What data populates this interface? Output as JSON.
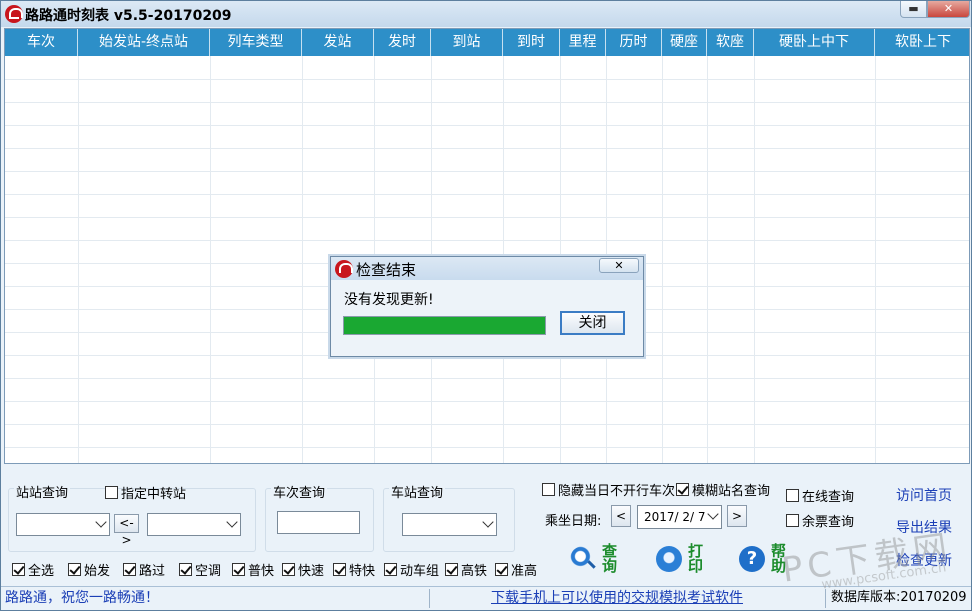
{
  "window": {
    "title": "路路通时刻表 v5.5-20170209",
    "minimize_glyph": "▬",
    "close_glyph": "✕"
  },
  "table": {
    "columns": [
      "车次",
      "始发站-终点站",
      "列车类型",
      "发站",
      "发时",
      "到站",
      "到时",
      "里程",
      "历时",
      "硬座",
      "软座",
      "硬卧上中下",
      "软卧上下"
    ],
    "rows": []
  },
  "station_query": {
    "label": "站站查询",
    "transfer_label": "指定中转站",
    "transfer_checked": false,
    "swap_label": "<->",
    "from_value": "",
    "to_value": ""
  },
  "train_query": {
    "label": "车次查询",
    "value": ""
  },
  "station_lookup": {
    "label": "车站查询",
    "value": ""
  },
  "filters": [
    {
      "label": "全选",
      "checked": true
    },
    {
      "label": "始发",
      "checked": true
    },
    {
      "label": "路过",
      "checked": true
    },
    {
      "label": "空调",
      "checked": true
    },
    {
      "label": "普快",
      "checked": true
    },
    {
      "label": "快速",
      "checked": true
    },
    {
      "label": "特快",
      "checked": true
    },
    {
      "label": "动车组",
      "checked": true
    },
    {
      "label": "高铁",
      "checked": true
    },
    {
      "label": "准高",
      "checked": true
    }
  ],
  "options": {
    "hide_not_running": {
      "label": "隐藏当日不开行车次",
      "checked": false
    },
    "fuzzy_station": {
      "label": "模糊站名查询",
      "checked": true
    },
    "online_query": {
      "label": "在线查询",
      "checked": false
    },
    "ticket_query": {
      "label": "余票查询",
      "checked": false
    }
  },
  "date": {
    "label": "乘坐日期:",
    "prev": "<",
    "next": ">",
    "value": "2017/ 2/ 7"
  },
  "actions": {
    "search": "查询",
    "print": "打印",
    "help": "帮助",
    "help_glyph": "?"
  },
  "links": {
    "home": "访问首页",
    "export": "导出结果",
    "check_update": "检查更新"
  },
  "statusbar": {
    "left": "路路通，祝您一路畅通！",
    "middle": "下载手机上可以使用的交规模拟考试软件",
    "right": "数据库版本:20170209"
  },
  "dialog": {
    "title": "检查结束",
    "message": "没有发现更新!",
    "close_button": "关闭",
    "close_glyph": "✕",
    "progress": 1.0
  },
  "watermark": {
    "text": "PC下载网",
    "sub": "www.pcsoft.com.cn"
  },
  "colors": {
    "header_bg": "#2d8fc8",
    "progress_fill": "#1aa832",
    "link": "#1b3fb6",
    "action_label": "#1c8c2c"
  }
}
